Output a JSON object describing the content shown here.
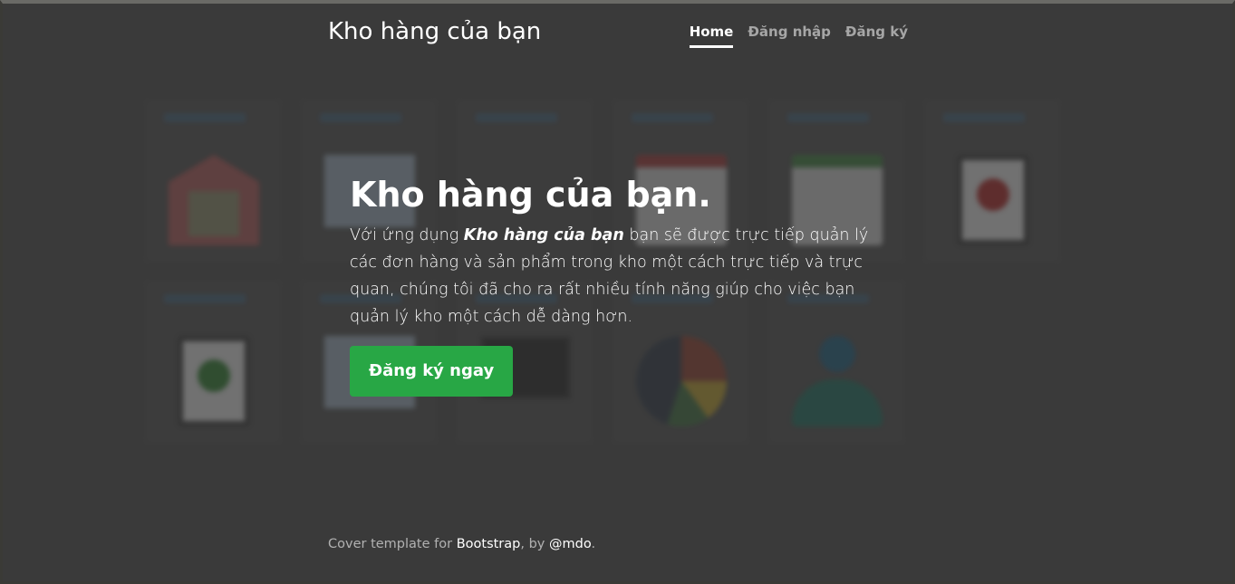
{
  "header": {
    "brand": "Kho hàng của bạn",
    "nav": [
      "Home",
      "Đăng nhập",
      "Đăng ký"
    ]
  },
  "cover": {
    "heading": "Kho hàng của bạn.",
    "lead_before": "Với ứng dụng ",
    "lead_emphasis": "Kho hàng của bạn",
    "lead_after": " bạn sẽ được trực tiếp quản lý các đơn hàng và sản phẩm trong kho một cách trực tiếp và trực quan, chúng tôi đã cho ra rất nhiều tính năng giúp cho việc bạn quản lý kho một cách dễ dàng hơn.",
    "cta_label": "Đăng ký ngay"
  },
  "footer": {
    "prefix": "Cover template for ",
    "link1": "Bootstrap",
    "middle": ", by ",
    "link2": "@mdo",
    "suffix": "."
  },
  "colors": {
    "accent": "#28a745",
    "background": "#444444"
  }
}
